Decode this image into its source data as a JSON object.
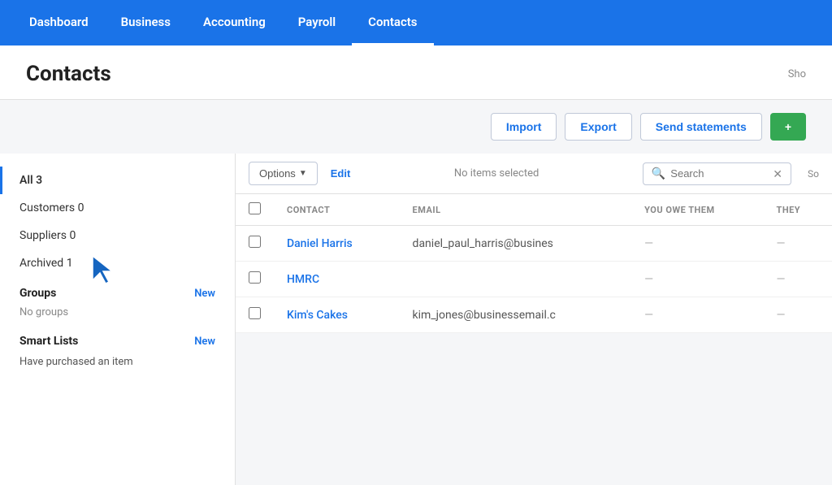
{
  "nav": {
    "items": [
      {
        "label": "Dashboard",
        "active": false
      },
      {
        "label": "Business",
        "active": false
      },
      {
        "label": "Accounting",
        "active": false
      },
      {
        "label": "Payroll",
        "active": false
      },
      {
        "label": "Contacts",
        "active": true
      }
    ]
  },
  "page": {
    "title": "Contacts",
    "show_label": "Sho"
  },
  "toolbar": {
    "import_label": "Import",
    "export_label": "Export",
    "send_statements_label": "Send statements",
    "new_btn_label": "+"
  },
  "sidebar": {
    "filters": [
      {
        "label": "All",
        "count": "3",
        "active": true
      },
      {
        "label": "Customers",
        "count": "0",
        "active": false
      },
      {
        "label": "Suppliers",
        "count": "0",
        "active": false
      },
      {
        "label": "Archived",
        "count": "1",
        "active": false
      }
    ],
    "groups": {
      "section_title": "Groups",
      "new_label": "New",
      "empty_label": "No groups"
    },
    "smart_lists": {
      "section_title": "Smart Lists",
      "new_label": "New",
      "items": [
        "Have purchased an item"
      ]
    }
  },
  "action_bar": {
    "options_label": "Options",
    "edit_label": "Edit",
    "no_items_selected": "No items selected",
    "search_placeholder": "Search",
    "sort_label": "So"
  },
  "table": {
    "columns": [
      "CONTACT",
      "EMAIL",
      "YOU OWE THEM",
      "THEY"
    ],
    "rows": [
      {
        "name": "Daniel Harris",
        "email": "daniel_paul_harris@busines",
        "you_owe": "—",
        "they": "—"
      },
      {
        "name": "HMRC",
        "email": "",
        "you_owe": "—",
        "they": "—"
      },
      {
        "name": "Kim's Cakes",
        "email": "kim_jones@businessemail.c",
        "you_owe": "—",
        "they": "—"
      }
    ]
  }
}
